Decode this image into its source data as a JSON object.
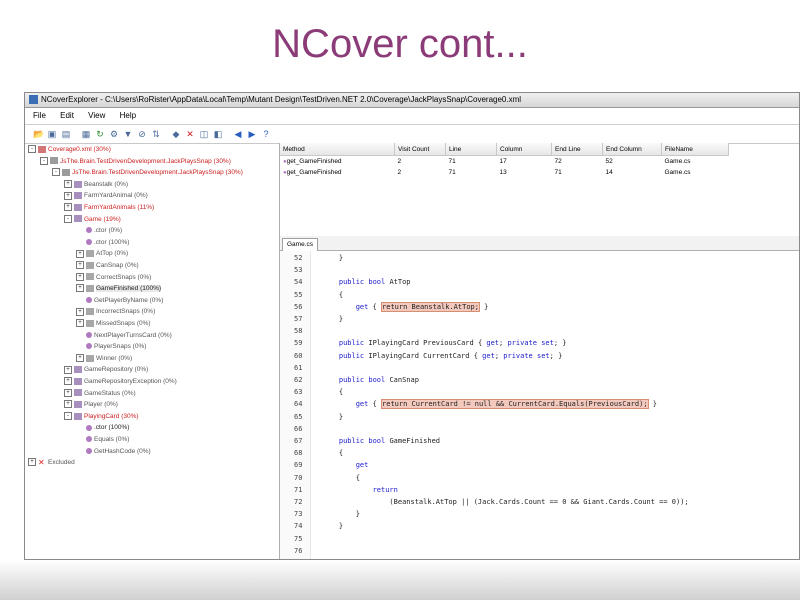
{
  "slide": {
    "title": "NCover cont..."
  },
  "window": {
    "title": "NCoverExplorer - C:\\Users\\RoRister\\AppData\\Local\\Temp\\Mutant Design\\TestDriven.NET 2.0\\Coverage\\JackPlaysSnap\\Coverage0.xml"
  },
  "menu": [
    "File",
    "Edit",
    "View",
    "Help"
  ],
  "toolbar": {
    "icons": [
      "open-icon",
      "save-icon",
      "save-as-icon",
      "report-icon",
      "refresh-icon",
      "options-icon",
      "filter-icon",
      "exclude-icon",
      "sort-icon",
      "highlight-icon",
      "delete-icon",
      "xml-icon",
      "html-icon",
      "back-icon",
      "forward-icon",
      "help-icon"
    ]
  },
  "tree": [
    {
      "label": "Coverage0.xml (30%)",
      "color": "red",
      "exp": "-",
      "icon": "coverage-file-icon"
    },
    {
      "label": "JsThe.Brain.TestDrivenDevelopment.JackPlaysSnap (30%)",
      "color": "red",
      "exp": "-",
      "icon": "module-icon"
    },
    {
      "label": "JsThe.Brain.TestDrivenDevelopment.JackPlaysSnap (30%)",
      "color": "red",
      "exp": "-",
      "icon": "namespace-icon"
    },
    {
      "label": "Beanstalk (0%)",
      "color": "gray",
      "exp": "+",
      "icon": "class-icon"
    },
    {
      "label": "FarmYardAnimal (0%)",
      "color": "gray",
      "exp": "+",
      "icon": "class-icon"
    },
    {
      "label": "FarmYardAnimals (11%)",
      "color": "red",
      "exp": "+",
      "icon": "class-icon"
    },
    {
      "label": "Game (19%)",
      "color": "red",
      "exp": "-",
      "icon": "class-icon"
    },
    {
      "label": ".ctor (0%)",
      "color": "gray",
      "exp": "",
      "icon": "method-icon"
    },
    {
      "label": ".ctor (100%)",
      "color": "gray",
      "exp": "",
      "icon": "method-icon"
    },
    {
      "label": "AtTop (0%)",
      "color": "gray",
      "exp": "+",
      "icon": "property-icon"
    },
    {
      "label": "CanSnap (0%)",
      "color": "gray",
      "exp": "+",
      "icon": "property-icon"
    },
    {
      "label": "CorrectSnaps (0%)",
      "color": "gray",
      "exp": "+",
      "icon": "property-icon"
    },
    {
      "label": "GameFinished (100%)",
      "color": "black",
      "exp": "+",
      "icon": "property-icon"
    },
    {
      "label": "GetPlayerByName (0%)",
      "color": "gray",
      "exp": "",
      "icon": "method-icon"
    },
    {
      "label": "IncorrectSnaps (0%)",
      "color": "gray",
      "exp": "+",
      "icon": "property-icon"
    },
    {
      "label": "MissedSnaps (0%)",
      "color": "gray",
      "exp": "+",
      "icon": "property-icon"
    },
    {
      "label": "NextPlayerTurnsCard (0%)",
      "color": "gray",
      "exp": "",
      "icon": "method-icon"
    },
    {
      "label": "PlayerSnaps (0%)",
      "color": "gray",
      "exp": "",
      "icon": "method-icon"
    },
    {
      "label": "Winner (0%)",
      "color": "gray",
      "exp": "+",
      "icon": "property-icon"
    },
    {
      "label": "GameRepository (0%)",
      "color": "gray",
      "exp": "+",
      "icon": "class-icon"
    },
    {
      "label": "GameRepositoryException (0%)",
      "color": "gray",
      "exp": "+",
      "icon": "class-icon"
    },
    {
      "label": "GameStatus (0%)",
      "color": "gray",
      "exp": "+",
      "icon": "class-icon"
    },
    {
      "label": "Player (0%)",
      "color": "gray",
      "exp": "+",
      "icon": "class-icon"
    },
    {
      "label": "PlayingCard (30%)",
      "color": "red",
      "exp": "-",
      "icon": "class-icon"
    },
    {
      "label": ".ctor (100%)",
      "color": "black",
      "exp": "",
      "icon": "method-icon"
    },
    {
      "label": "Equals (0%)",
      "color": "gray",
      "exp": "",
      "icon": "method-icon"
    },
    {
      "label": "GetHashCode (0%)",
      "color": "gray",
      "exp": "",
      "icon": "method-icon"
    },
    {
      "label": "Excluded",
      "color": "gray",
      "exp": "+",
      "icon": "excluded-icon"
    }
  ],
  "table": {
    "columns": [
      "Method",
      "Visit Count",
      "Line",
      "Column",
      "End Line",
      "End Column",
      "FileName"
    ],
    "rows": [
      [
        "get_GameFinished",
        "2",
        "71",
        "17",
        "72",
        "52",
        "Game.cs"
      ],
      [
        "get_GameFinished",
        "2",
        "71",
        "13",
        "71",
        "14",
        "Game.cs"
      ]
    ]
  },
  "tab": {
    "label": "Game.cs"
  },
  "code": [
    {
      "n": "52",
      "t": "    }"
    },
    {
      "n": "53",
      "t": ""
    },
    {
      "n": "54",
      "t": "    public bool AtTop"
    },
    {
      "n": "55",
      "t": "    {"
    },
    {
      "n": "56",
      "pre": "        get { ",
      "hl": "return Beanstalk.AtTop;",
      "post": " }"
    },
    {
      "n": "57",
      "t": "    }"
    },
    {
      "n": "58",
      "t": ""
    },
    {
      "n": "59",
      "t": "    public IPlayingCard PreviousCard { get; private set; }"
    },
    {
      "n": "60",
      "t": "    public IPlayingCard CurrentCard { get; private set; }"
    },
    {
      "n": "61",
      "t": ""
    },
    {
      "n": "62",
      "t": "    public bool CanSnap"
    },
    {
      "n": "63",
      "t": "    {"
    },
    {
      "n": "64",
      "pre": "        get { ",
      "hl": "return CurrentCard != null && CurrentCard.Equals(PreviousCard);",
      "post": " }"
    },
    {
      "n": "65",
      "t": "    }"
    },
    {
      "n": "66",
      "t": ""
    },
    {
      "n": "67",
      "t": "    public bool GameFinished"
    },
    {
      "n": "68",
      "t": "    {"
    },
    {
      "n": "69",
      "t": "        get"
    },
    {
      "n": "70",
      "t": "        {"
    },
    {
      "n": "71",
      "t": "            return"
    },
    {
      "n": "72",
      "t": "                (Beanstalk.AtTop || (Jack.Cards.Count == 0 && Giant.Cards.Count == 0));"
    },
    {
      "n": "73",
      "t": "        }"
    },
    {
      "n": "74",
      "t": "    }"
    },
    {
      "n": "75",
      "t": ""
    },
    {
      "n": "76",
      "t": ""
    }
  ]
}
